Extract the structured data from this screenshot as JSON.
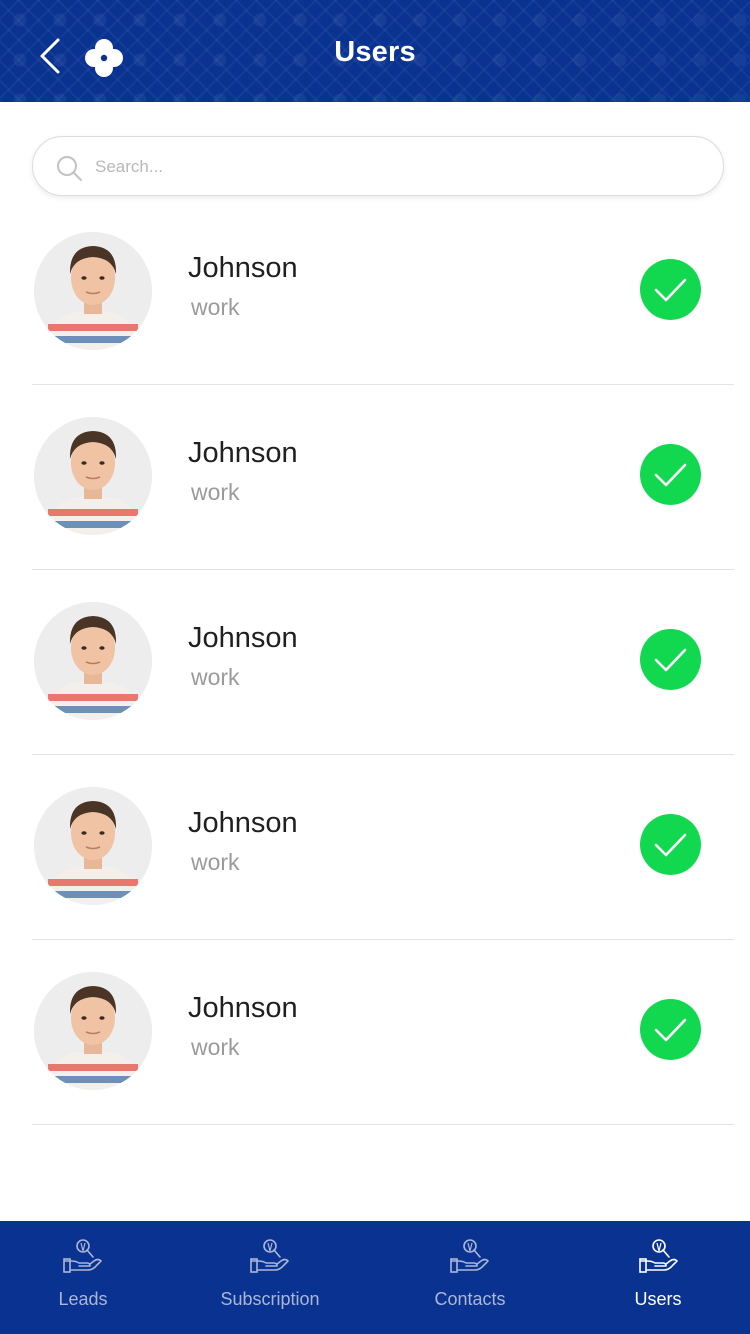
{
  "header": {
    "title": "Users",
    "back_icon": "chevron-left-icon",
    "logo_icon": "clover-logo-icon"
  },
  "search": {
    "placeholder": "Search...",
    "value": "",
    "icon": "search-icon"
  },
  "users": [
    {
      "name": "Johnson",
      "role": "work",
      "selected": true
    },
    {
      "name": "Johnson",
      "role": "work",
      "selected": true
    },
    {
      "name": "Johnson",
      "role": "work",
      "selected": true
    },
    {
      "name": "Johnson",
      "role": "work",
      "selected": true
    },
    {
      "name": "Johnson",
      "role": "work",
      "selected": true
    }
  ],
  "tabs": [
    {
      "label": "Leads",
      "icon": "hand-holding-icon",
      "active": false
    },
    {
      "label": "Subscription",
      "icon": "hand-holding-icon",
      "active": false
    },
    {
      "label": "Contacts",
      "icon": "hand-holding-icon",
      "active": false
    },
    {
      "label": "Users",
      "icon": "hand-holding-icon",
      "active": true
    }
  ],
  "colors": {
    "primary": "#0a3391",
    "success": "#12d850",
    "tab_inactive": "#aab6d6",
    "tab_active": "#ffffff"
  }
}
